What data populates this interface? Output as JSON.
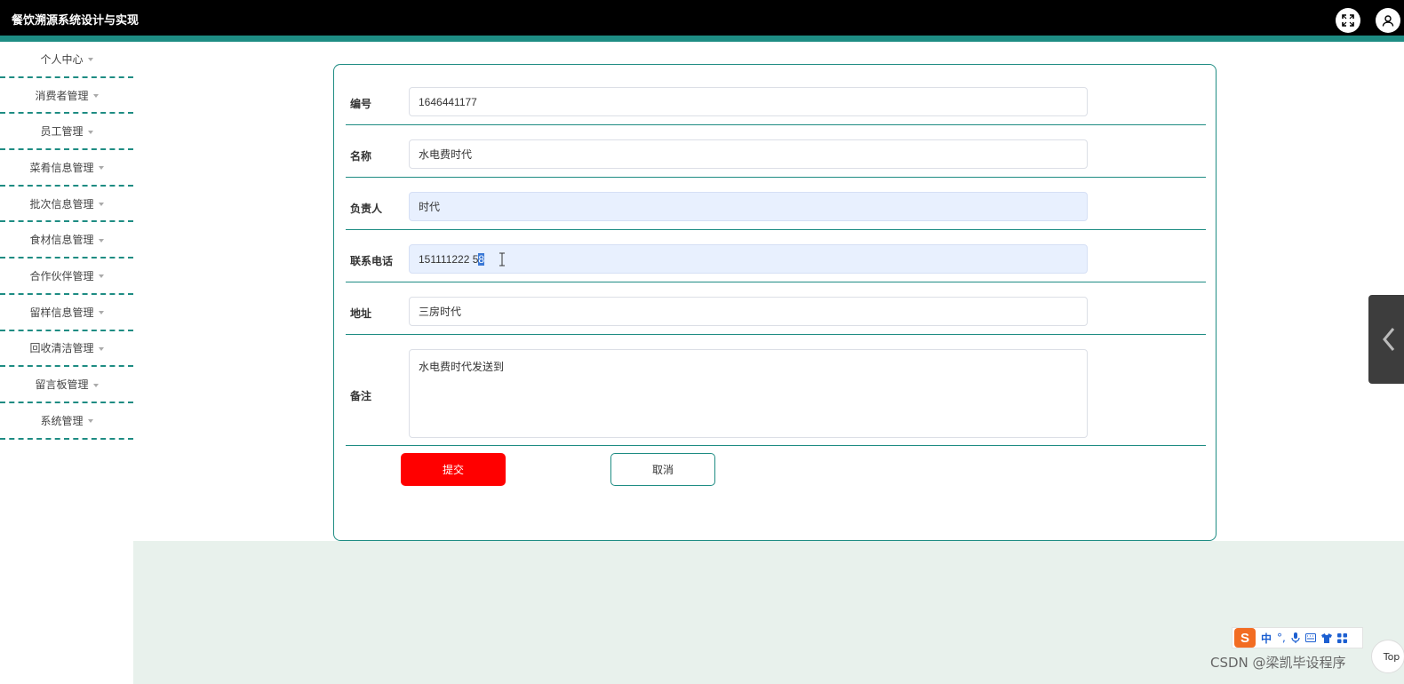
{
  "app": {
    "title": "餐饮溯源系统设计与实现"
  },
  "sidebar": {
    "items": [
      {
        "label": "个人中心"
      },
      {
        "label": "消费者管理"
      },
      {
        "label": "员工管理"
      },
      {
        "label": "菜肴信息管理"
      },
      {
        "label": "批次信息管理"
      },
      {
        "label": "食材信息管理"
      },
      {
        "label": "合作伙伴管理"
      },
      {
        "label": "留样信息管理"
      },
      {
        "label": "回收清洁管理"
      },
      {
        "label": "留言板管理"
      },
      {
        "label": "系统管理"
      }
    ]
  },
  "form": {
    "fields": {
      "id": {
        "label": "编号",
        "value": "1646441177"
      },
      "name": {
        "label": "名称",
        "value": "水电费时代"
      },
      "manager": {
        "label": "负责人",
        "value": "时代"
      },
      "phone": {
        "label": "联系电话",
        "value_main": "151111222 5",
        "value_selected": "8"
      },
      "address": {
        "label": "地址",
        "value": "三房时代"
      },
      "remark": {
        "label": "备注",
        "value": "水电费时代发送到"
      }
    },
    "submit_label": "提交",
    "cancel_label": "取消"
  },
  "ime": {
    "logo": "S",
    "mode": "中"
  },
  "top_button": {
    "label": "Top"
  },
  "watermark": "CSDN @梁凯毕设程序",
  "colors": {
    "accent": "#1e8c83",
    "submit": "#ff0000",
    "header": "#000000"
  }
}
